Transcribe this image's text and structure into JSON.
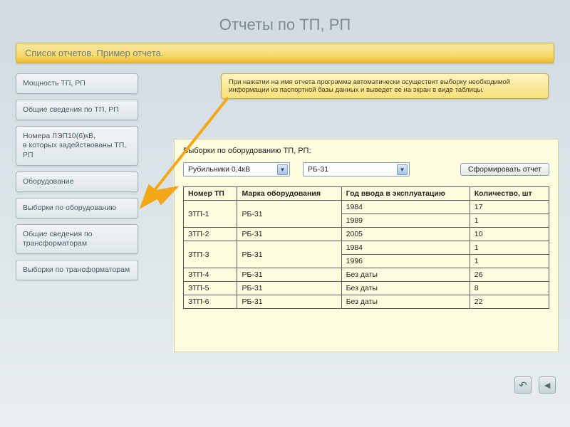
{
  "title": "Отчеты по ТП, РП",
  "subtitle": "Список отчетов. Пример отчета.",
  "sidebar": {
    "items": [
      {
        "label": "Мощность ТП, РП"
      },
      {
        "label": "Общие сведения по ТП, РП"
      },
      {
        "label": "Номера ЛЭП10(6)кВ,\nв которых задействованы ТП, РП"
      },
      {
        "label": "Оборудование"
      },
      {
        "label": "Выборки по оборудованию"
      },
      {
        "label": "Общие сведения по трансформаторам"
      },
      {
        "label": "Выборки по трансформаторам"
      }
    ]
  },
  "callout": "При нажатии на имя отчета программа автоматически осуществит выборку необходимой информации из паспортной базы данных и выведет ее на экран в виде таблицы.",
  "panel": {
    "heading": "Выборки по оборудованию ТП, РП:",
    "dropdown1": "Рубильники 0,4кВ",
    "dropdown2": "РБ-31",
    "submit": "Сформировать отчет",
    "columns": [
      "Номер ТП",
      "Марка оборудования",
      "Год ввода в эксплуатацию",
      "Количество, шт"
    ],
    "rows": [
      {
        "tp": "ЗТП-1",
        "mark": "РБ-31",
        "sub": [
          [
            "1984",
            "17"
          ],
          [
            "1989",
            "1"
          ]
        ]
      },
      {
        "tp": "ЗТП-2",
        "mark": "РБ-31",
        "sub": [
          [
            "2005",
            "10"
          ]
        ]
      },
      {
        "tp": "ЗТП-3",
        "mark": "РБ-31",
        "sub": [
          [
            "1984",
            "1"
          ],
          [
            "1996",
            "1"
          ]
        ]
      },
      {
        "tp": "ЗТП-4",
        "mark": "РБ-31",
        "sub": [
          [
            "Без даты",
            "26"
          ]
        ]
      },
      {
        "tp": "ЗТП-5",
        "mark": "РБ-31",
        "sub": [
          [
            "Без даты",
            "8"
          ]
        ]
      },
      {
        "tp": "ЗТП-6",
        "mark": "РБ-31",
        "sub": [
          [
            "Без даты",
            "22"
          ]
        ]
      }
    ]
  },
  "chart_data": {
    "type": "table",
    "title": "Выборки по оборудованию ТП, РП",
    "columns": [
      "Номер ТП",
      "Марка оборудования",
      "Год ввода в эксплуатацию",
      "Количество, шт"
    ],
    "records": [
      [
        "ЗТП-1",
        "РБ-31",
        "1984",
        17
      ],
      [
        "ЗТП-1",
        "РБ-31",
        "1989",
        1
      ],
      [
        "ЗТП-2",
        "РБ-31",
        "2005",
        10
      ],
      [
        "ЗТП-3",
        "РБ-31",
        "1984",
        1
      ],
      [
        "ЗТП-3",
        "РБ-31",
        "1996",
        1
      ],
      [
        "ЗТП-4",
        "РБ-31",
        "Без даты",
        26
      ],
      [
        "ЗТП-5",
        "РБ-31",
        "Без даты",
        8
      ],
      [
        "ЗТП-6",
        "РБ-31",
        "Без даты",
        22
      ]
    ]
  }
}
